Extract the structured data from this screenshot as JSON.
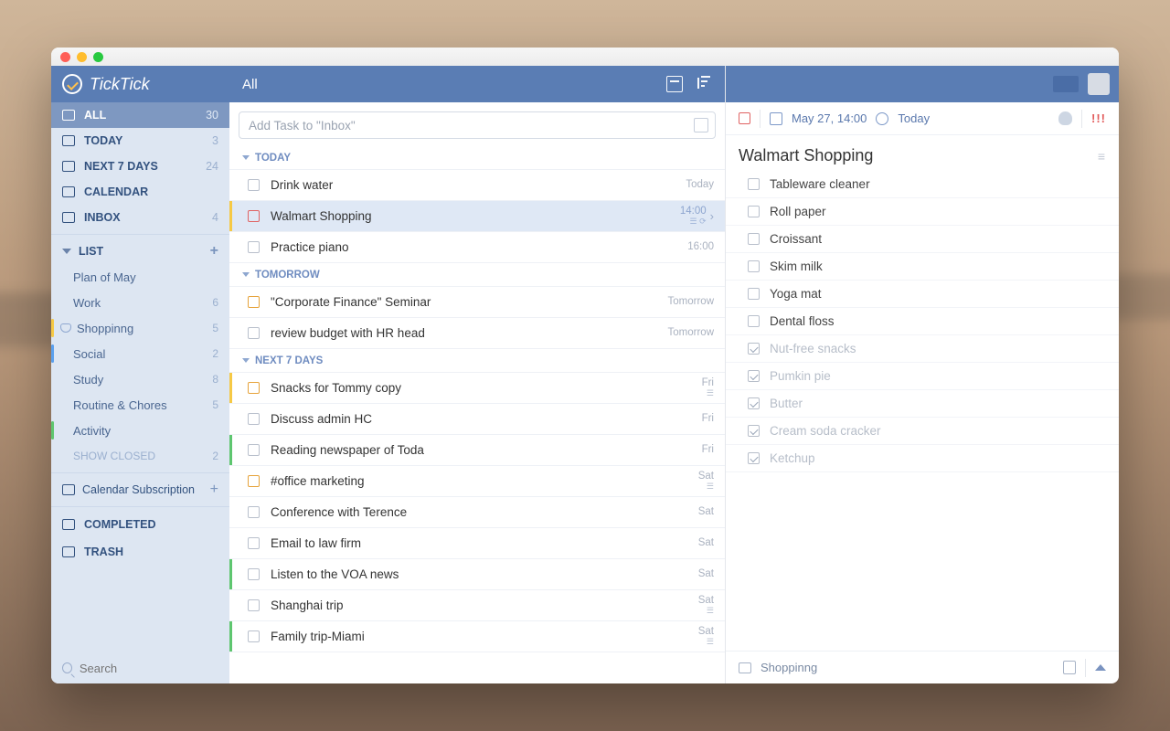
{
  "brand": "TickTick",
  "sidebar": {
    "smart": [
      {
        "icon": "inbox",
        "label": "ALL",
        "count": "30",
        "selected": true
      },
      {
        "icon": "today",
        "label": "TODAY",
        "count": "3"
      },
      {
        "icon": "week",
        "label": "NEXT 7 DAYS",
        "count": "24"
      },
      {
        "icon": "calendar",
        "label": "CALENDAR",
        "count": ""
      },
      {
        "icon": "inbox",
        "label": "INBOX",
        "count": "4"
      }
    ],
    "list_header": "LIST",
    "lists": [
      {
        "label": "Plan of May",
        "count": "",
        "stripe": ""
      },
      {
        "label": "Work",
        "count": "6",
        "stripe": ""
      },
      {
        "label": "Shoppinng",
        "count": "5",
        "stripe": "#f6c945",
        "shared": true
      },
      {
        "label": "Social",
        "count": "2",
        "stripe": "#5aa0ee"
      },
      {
        "label": "Study",
        "count": "8",
        "stripe": ""
      },
      {
        "label": "Routine & Chores",
        "count": "5",
        "stripe": ""
      },
      {
        "label": "Activity",
        "count": "",
        "stripe": "#5ec66f"
      }
    ],
    "show_closed": {
      "label": "SHOW CLOSED",
      "count": "2"
    },
    "calendar_sub": "Calendar Subscription",
    "completed": "COMPLETED",
    "trash": "TRASH",
    "search_placeholder": "Search"
  },
  "middle": {
    "title": "All",
    "add_placeholder": "Add Task to \"Inbox\"",
    "groups": [
      {
        "label": "TODAY",
        "tasks": [
          {
            "title": "Drink water",
            "meta": "Today",
            "bar": "",
            "chk": ""
          },
          {
            "title": "Walmart Shopping",
            "meta": "14:00",
            "bar": "#f6c945",
            "chk": "red",
            "selected": true,
            "icons": true
          },
          {
            "title": "Practice piano",
            "meta": "16:00",
            "bar": "",
            "chk": ""
          }
        ]
      },
      {
        "label": "TOMORROW",
        "tasks": [
          {
            "title": "\"Corporate Finance\" Seminar",
            "meta": "Tomorrow",
            "bar": "",
            "chk": "orange"
          },
          {
            "title": "review budget with HR head",
            "meta": "Tomorrow",
            "bar": "",
            "chk": ""
          }
        ]
      },
      {
        "label": "NEXT 7 DAYS",
        "tasks": [
          {
            "title": "Snacks for Tommy copy",
            "meta": "Fri",
            "bar": "#f6c945",
            "chk": "orange",
            "sub": true
          },
          {
            "title": "Discuss admin HC",
            "meta": "Fri",
            "bar": "",
            "chk": ""
          },
          {
            "title": "Reading newspaper of Toda",
            "meta": "Fri",
            "bar": "#5ec66f",
            "chk": ""
          },
          {
            "title": "#office marketing",
            "meta": "Sat",
            "bar": "",
            "chk": "orange",
            "sub": true
          },
          {
            "title": "Conference with Terence",
            "meta": "Sat",
            "bar": "",
            "chk": ""
          },
          {
            "title": "Email to law firm",
            "meta": "Sat",
            "bar": "",
            "chk": ""
          },
          {
            "title": "Listen to the VOA news",
            "meta": "Sat",
            "bar": "#5ec66f",
            "chk": ""
          },
          {
            "title": "Shanghai trip",
            "meta": "Sat",
            "bar": "",
            "chk": "",
            "sub": true
          },
          {
            "title": "Family trip-Miami",
            "meta": "Sat",
            "bar": "#5ec66f",
            "chk": "",
            "sub": true
          }
        ]
      }
    ]
  },
  "detail": {
    "date": "May 27, 14:00",
    "repeat": "Today",
    "priority": "!!!",
    "title": "Walmart Shopping",
    "items": [
      {
        "label": "Tableware cleaner",
        "done": false
      },
      {
        "label": "Roll paper",
        "done": false
      },
      {
        "label": "Croissant",
        "done": false
      },
      {
        "label": "Skim milk",
        "done": false
      },
      {
        "label": "Yoga mat",
        "done": false
      },
      {
        "label": "Dental floss",
        "done": false
      },
      {
        "label": "Nut-free snacks",
        "done": true
      },
      {
        "label": "Pumkin pie",
        "done": true
      },
      {
        "label": "Butter",
        "done": true
      },
      {
        "label": "Cream soda cracker",
        "done": true
      },
      {
        "label": "Ketchup",
        "done": true
      }
    ],
    "footer_list": "Shoppinng"
  }
}
